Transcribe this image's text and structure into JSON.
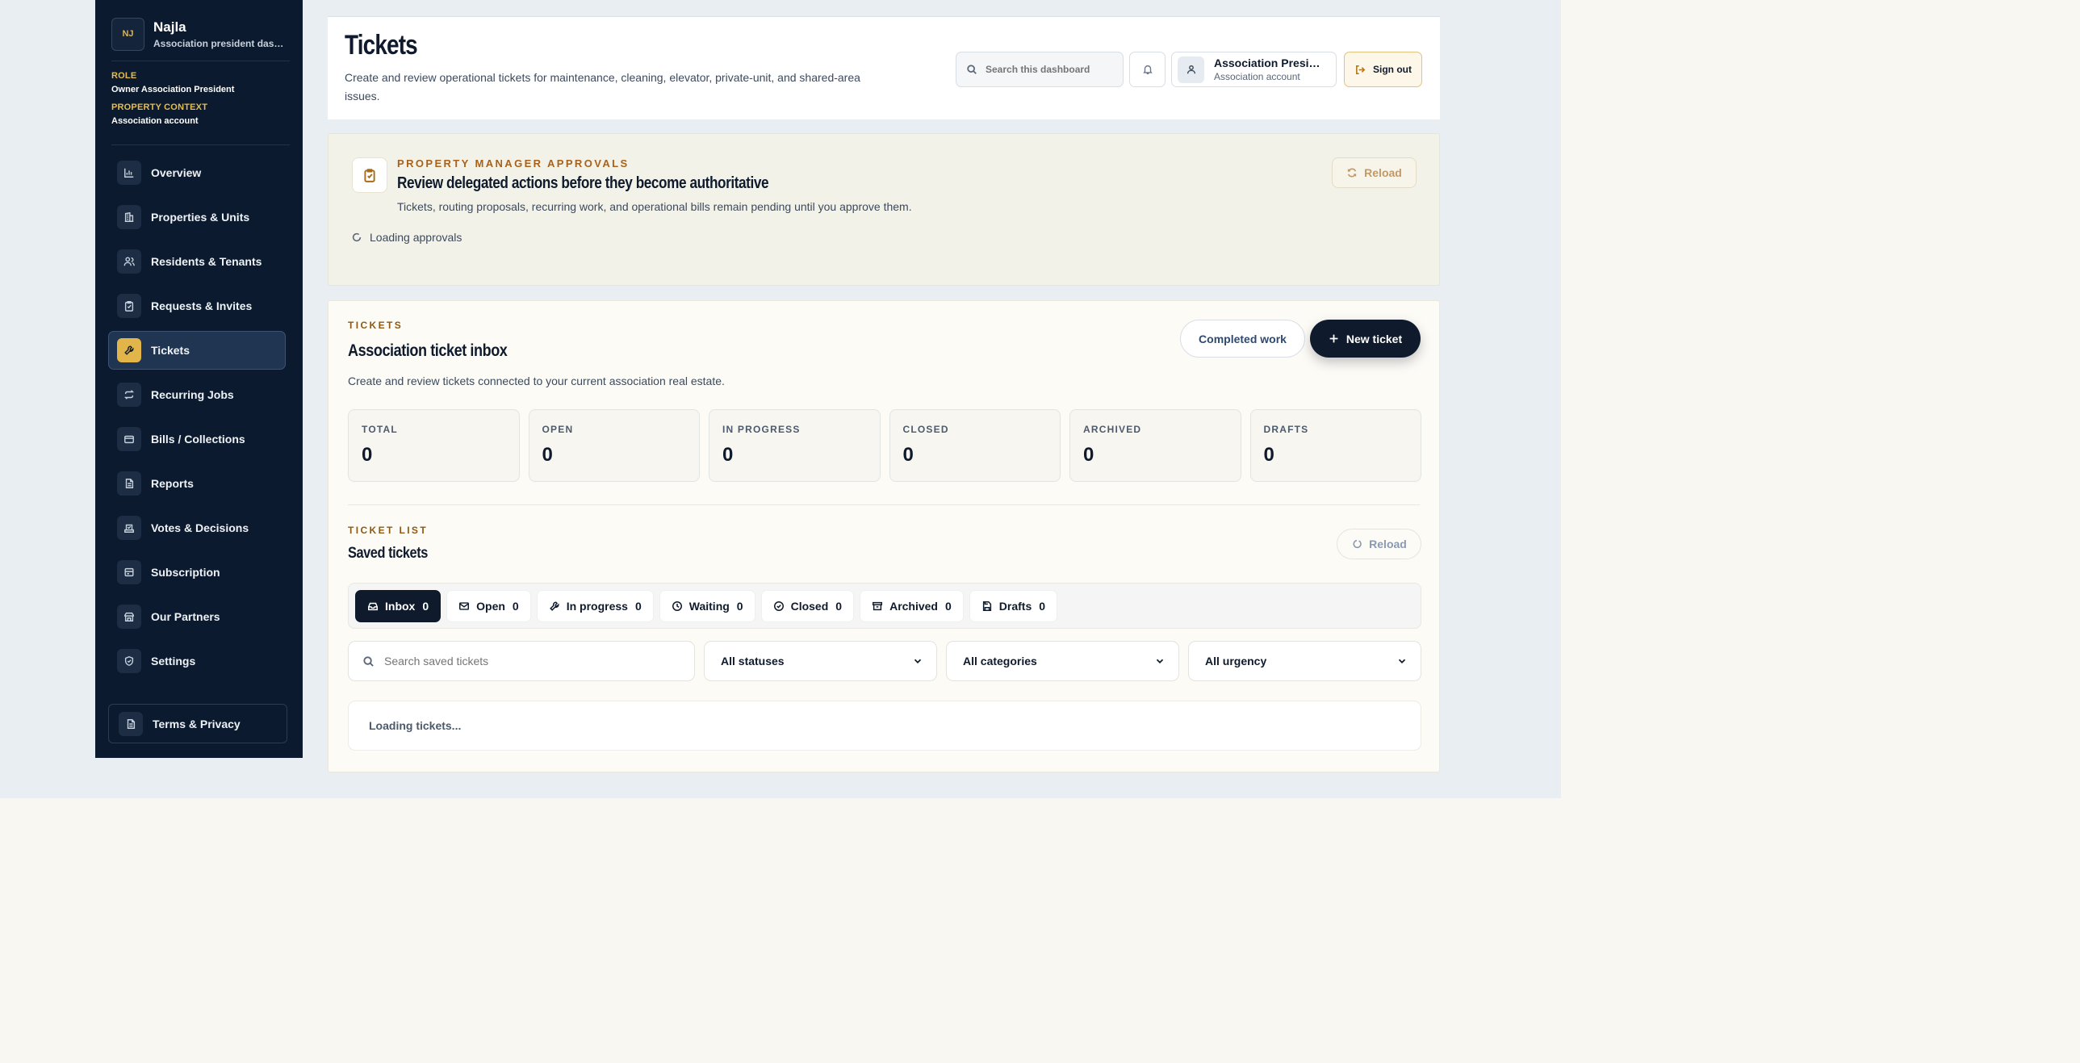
{
  "brand": {
    "logo_text": "NJ",
    "name": "Najla",
    "subtitle": "Association president dashboard"
  },
  "context": {
    "role_label": "ROLE",
    "role_value": "Owner Association President",
    "property_label": "PROPERTY CONTEXT",
    "property_value": "Association account"
  },
  "sidebar": {
    "items": [
      {
        "label": "Overview",
        "icon": "chart-icon"
      },
      {
        "label": "Properties & Units",
        "icon": "building-icon"
      },
      {
        "label": "Residents & Tenants",
        "icon": "users-icon"
      },
      {
        "label": "Requests & Invites",
        "icon": "clipboard-icon"
      },
      {
        "label": "Tickets",
        "icon": "wrench-icon",
        "active": true
      },
      {
        "label": "Recurring Jobs",
        "icon": "repeat-icon"
      },
      {
        "label": "Bills / Collections",
        "icon": "card-icon"
      },
      {
        "label": "Reports",
        "icon": "document-icon"
      },
      {
        "label": "Votes & Decisions",
        "icon": "ballot-icon"
      },
      {
        "label": "Subscription",
        "icon": "subscription-icon"
      },
      {
        "label": "Our Partners",
        "icon": "partners-icon"
      },
      {
        "label": "Settings",
        "icon": "shield-icon"
      }
    ],
    "terms_label": "Terms & Privacy"
  },
  "header": {
    "title": "Tickets",
    "subtitle": "Create and review operational tickets for maintenance, cleaning, elevator, private-unit, and shared-area issues.",
    "search_placeholder": "Search this dashboard",
    "account_name": "Association President",
    "account_type": "Association account",
    "signout_label": "Sign out"
  },
  "approvals": {
    "eyebrow": "PROPERTY MANAGER APPROVALS",
    "title": "Review delegated actions before they become authoritative",
    "subtitle": "Tickets, routing proposals, recurring work, and operational bills remain pending until you approve them.",
    "loading": "Loading approvals",
    "reload_label": "Reload"
  },
  "inbox": {
    "eyebrow": "TICKETS",
    "title": "Association ticket inbox",
    "subtitle": "Create and review tickets connected to your current association real estate.",
    "completed_label": "Completed work",
    "new_label": "New ticket",
    "stats": [
      {
        "label": "TOTAL",
        "value": "0"
      },
      {
        "label": "OPEN",
        "value": "0"
      },
      {
        "label": "IN PROGRESS",
        "value": "0"
      },
      {
        "label": "CLOSED",
        "value": "0"
      },
      {
        "label": "ARCHIVED",
        "value": "0"
      },
      {
        "label": "DRAFTS",
        "value": "0"
      }
    ],
    "list_eyebrow": "TICKET LIST",
    "list_title": "Saved tickets",
    "list_reload": "Reload",
    "tabs": [
      {
        "label": "Inbox",
        "count": "0",
        "icon": "inbox-icon",
        "active": true
      },
      {
        "label": "Open",
        "count": "0",
        "icon": "mail-icon"
      },
      {
        "label": "In progress",
        "count": "0",
        "icon": "wrench-icon"
      },
      {
        "label": "Waiting",
        "count": "0",
        "icon": "clock-icon"
      },
      {
        "label": "Closed",
        "count": "0",
        "icon": "check-circle-icon"
      },
      {
        "label": "Archived",
        "count": "0",
        "icon": "archive-icon"
      },
      {
        "label": "Drafts",
        "count": "0",
        "icon": "draft-icon"
      }
    ],
    "search_placeholder": "Search saved tickets",
    "filters": [
      "All statuses",
      "All categories",
      "All urgency"
    ],
    "loading": "Loading tickets..."
  }
}
